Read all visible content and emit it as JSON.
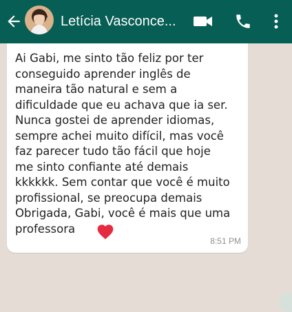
{
  "header": {
    "title": "Letícia Vasconce...",
    "back_icon": "back-arrow-icon",
    "video_icon": "video-call-icon",
    "call_icon": "phone-icon",
    "more_icon": "more-vertical-icon",
    "color": "#075e54"
  },
  "message": {
    "text": "Ai Gabi, me sinto tão feliz por ter\nconseguido aprender inglês de\nmaneira tão natural e sem a\ndificuldade que eu achava que ia ser.\nNunca gostei de aprender idiomas,\nsempre achei muito difícil, mas você\nfaz parecer tudo tão fácil que hoje\nme sinto confiante até demais\nkkkkkk. Sem contar que você é muito\nprofissional, se preocupa demais\nObrigada, Gabi, você é mais que uma\nprofessora",
    "emoji": "heart-icon",
    "time": "8:51 PM"
  },
  "colors": {
    "chat_background": "#e5ddd5",
    "bubble": "#ffffff",
    "heart": "#e52b3f"
  }
}
